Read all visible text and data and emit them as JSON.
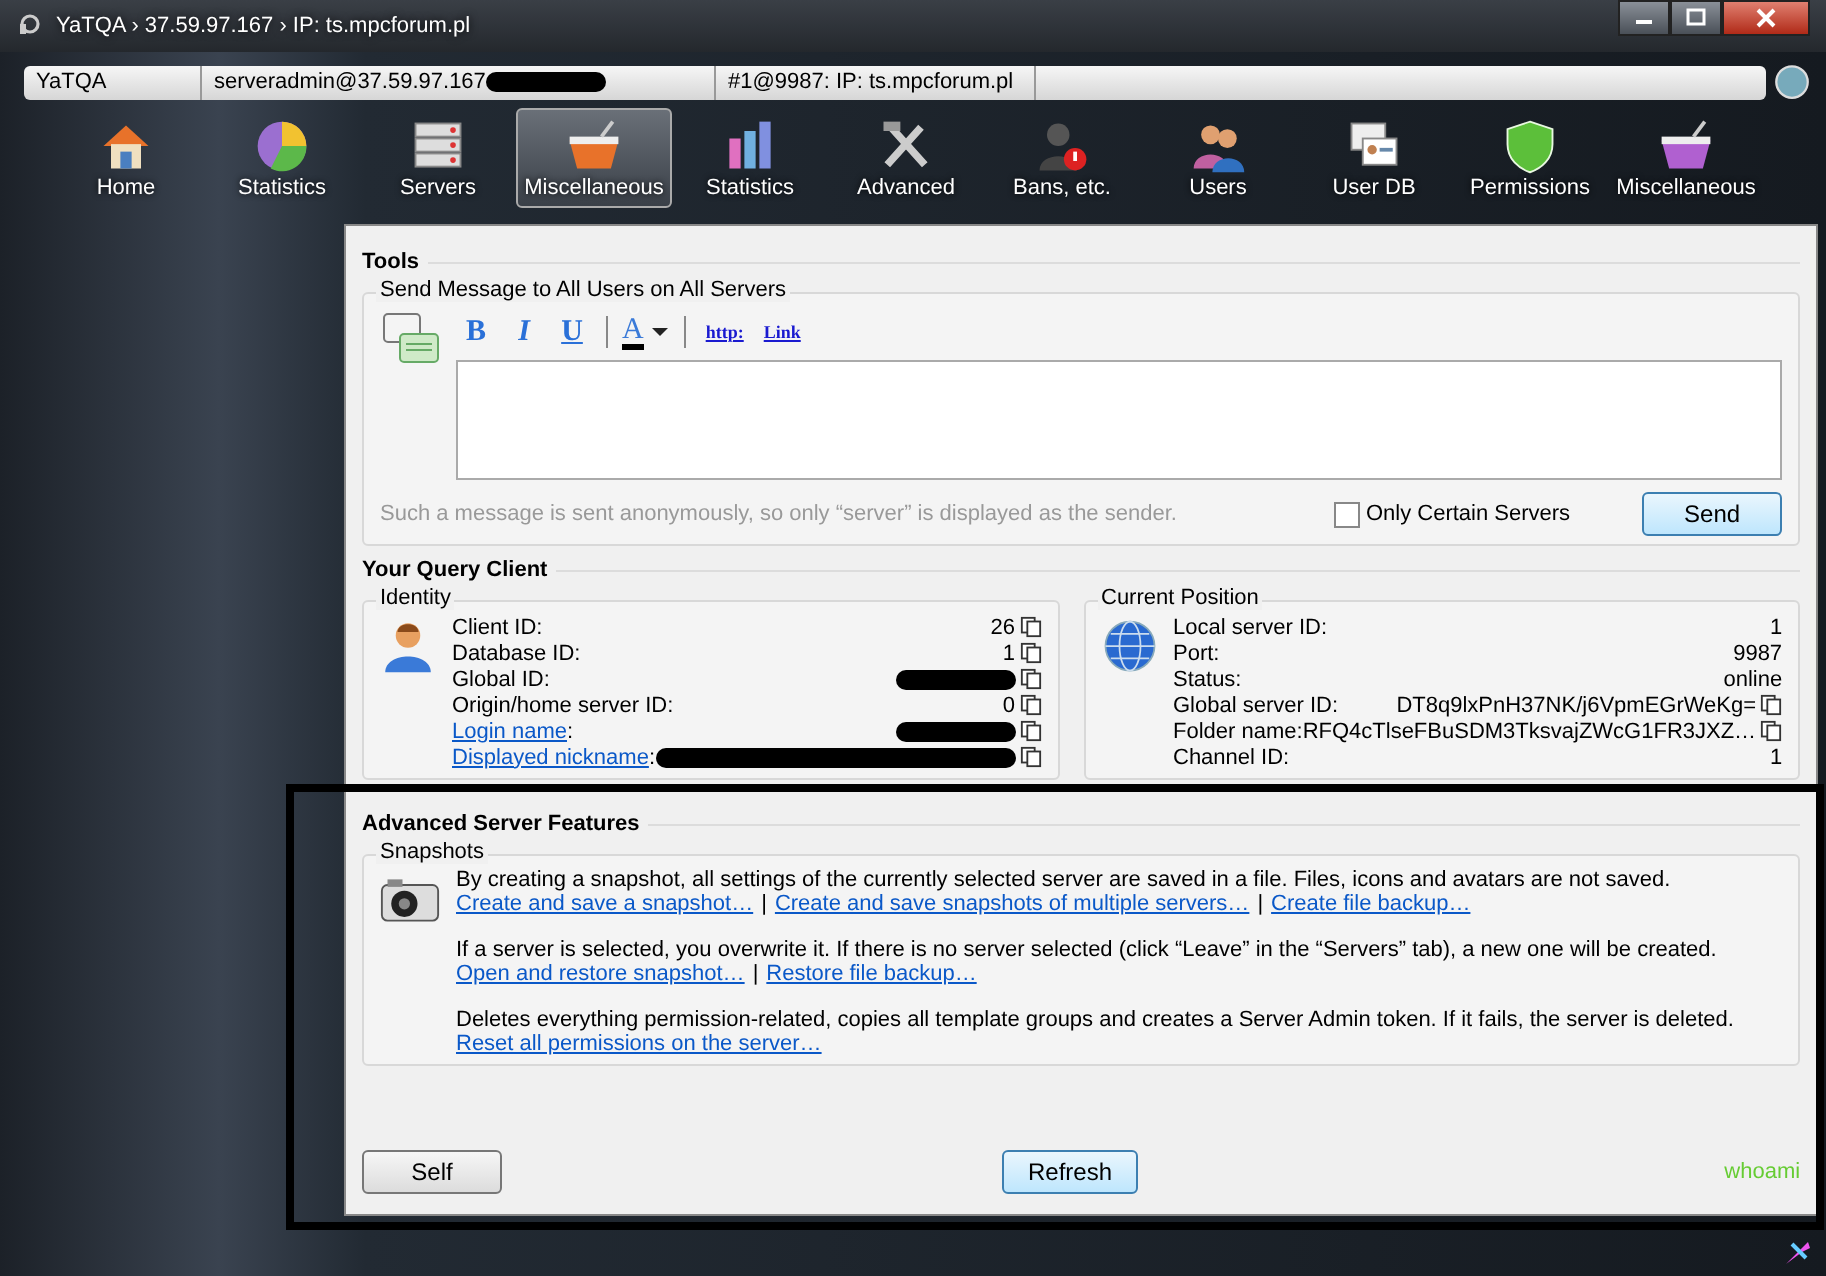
{
  "window": {
    "title": "YaTQA › 37.59.97.167 › IP: ts.mpcforum.pl"
  },
  "breadcrumb": [
    {
      "label": "YaTQA",
      "redacted": false
    },
    {
      "label": "serveradmin@37.59.97.167",
      "redacted": true
    },
    {
      "label": "#1@9987: IP: ts.mpcforum.pl",
      "redacted": false
    }
  ],
  "toolbar": [
    {
      "label": "Home",
      "selected": false
    },
    {
      "label": "Statistics",
      "selected": false
    },
    {
      "label": "Servers",
      "selected": false
    },
    {
      "label": "Miscellaneous",
      "selected": true
    },
    {
      "label": "Statistics",
      "selected": false
    },
    {
      "label": "Advanced",
      "selected": false
    },
    {
      "label": "Bans, etc.",
      "selected": false
    },
    {
      "label": "Users",
      "selected": false
    },
    {
      "label": "User DB",
      "selected": false
    },
    {
      "label": "Permissions",
      "selected": false
    },
    {
      "label": "Miscellaneous",
      "selected": false
    }
  ],
  "tools": {
    "title": "Tools",
    "group_title": "Send Message to All Users on All Servers",
    "format_buttons": [
      "B",
      "I",
      "U"
    ],
    "color_button": "A",
    "link_buttons": [
      "http:",
      "Link"
    ],
    "hint": "Such a message is sent anonymously, so only “server” is displayed as the sender.",
    "only_certain_servers": {
      "label": "Only Certain Servers",
      "checked": false
    },
    "send_button": "Send"
  },
  "query_client": {
    "title": "Your Query Client",
    "identity": {
      "title": "Identity",
      "rows": [
        {
          "label": "Client ID:",
          "value": "26",
          "link": false,
          "redacted": false
        },
        {
          "label": "Database ID:",
          "value": "1",
          "link": false,
          "redacted": false
        },
        {
          "label": "Global ID:",
          "link": false,
          "redacted": true
        },
        {
          "label": "Origin/home server ID:",
          "value": "0",
          "link": false,
          "redacted": false
        },
        {
          "label": "Login name",
          "suffix": ":",
          "link": true,
          "redacted": true
        },
        {
          "label": "Displayed nickname",
          "suffix": ":",
          "link": true,
          "redacted": true
        }
      ]
    },
    "position": {
      "title": "Current Position",
      "rows": [
        {
          "label": "Local server ID:",
          "value": "1",
          "copy": false
        },
        {
          "label": "Port:",
          "value": "9987",
          "copy": false
        },
        {
          "label": "Status:",
          "value": "online",
          "copy": false
        },
        {
          "label": "Global server ID:",
          "value": "DT8q9lxPnH37NK/j6VpmEGrWeKg=",
          "copy": true
        },
        {
          "label": "Folder name:",
          "value": "RFQ4cTlseFBuSDM3TksvajZWcG1FR3JXZ…",
          "copy": true
        },
        {
          "label": "Channel ID:",
          "value": "1",
          "copy": false
        }
      ]
    }
  },
  "advanced": {
    "title": "Advanced Server Features",
    "group_title": "Snapshots",
    "separator": "|",
    "paragraphs": [
      {
        "text": "By creating a snapshot, all settings of the currently selected server are saved in a file. Files, icons and avatars are not saved.",
        "links": [
          "Create and save a snapshot…",
          "Create and save snapshots of multiple servers…",
          "Create file backup…"
        ]
      },
      {
        "text": "If a server is selected, you overwrite it. If there is no server selected (click “Leave” in the “Servers” tab), a new one will be created.",
        "links": [
          "Open and restore snapshot…",
          "Restore file backup…"
        ]
      },
      {
        "text": "Deletes everything permission-related, copies all template groups and creates a Server Admin token. If it fails, the server is deleted.",
        "links": [
          "Reset all permissions on the server…"
        ]
      }
    ]
  },
  "footer": {
    "buttons": [
      "Self",
      "Refresh"
    ],
    "whoami": "whoami"
  }
}
